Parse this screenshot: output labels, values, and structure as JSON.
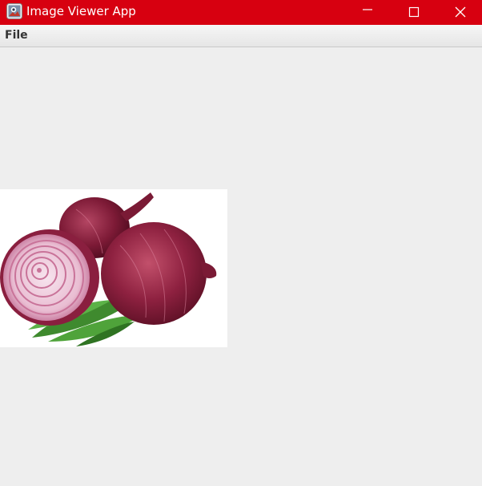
{
  "window": {
    "title": "Image Viewer App",
    "titlebar_color": "#d70010",
    "app_icon": "app-image-icon",
    "controls": {
      "minimize_icon": "minimize-icon",
      "maximize_icon": "maximize-icon",
      "close_icon": "close-icon"
    }
  },
  "menubar": {
    "items": [
      {
        "label": "File"
      }
    ]
  },
  "viewer": {
    "image_subject": "red onions with green leaves",
    "background": "#eeeeee"
  }
}
